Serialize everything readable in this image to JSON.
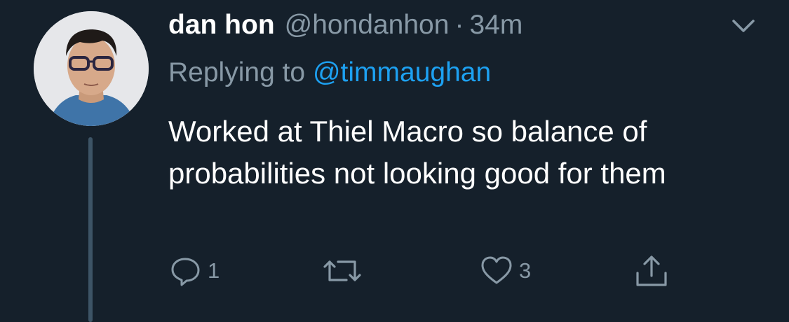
{
  "tweet": {
    "display_name": "dan hon",
    "handle": "@hondanhon",
    "separator": "·",
    "time": "34m",
    "replying_prefix": "Replying to",
    "replying_to": "@timmaughan",
    "text": "Worked at Thiel Macro so balance of probabilities not looking good for them"
  },
  "actions": {
    "reply_count": "1",
    "retweet_count": "",
    "like_count": "3"
  },
  "icons": {
    "menu": "chevron-down-icon",
    "reply": "speech-bubble-icon",
    "retweet": "retweet-icon",
    "like": "heart-icon",
    "share": "share-icon"
  },
  "colors": {
    "background": "#15202b",
    "text": "#ffffff",
    "secondary": "#8899a6",
    "accent": "#1da1f2",
    "thread_line": "#3d5466"
  }
}
